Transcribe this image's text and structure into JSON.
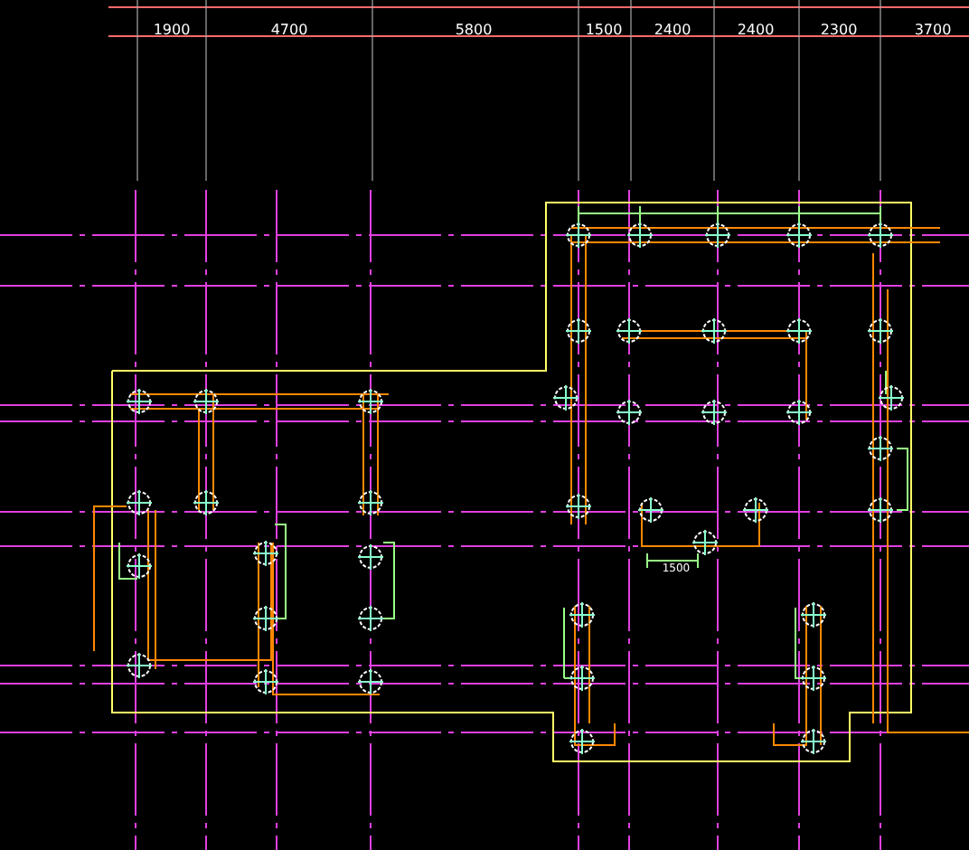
{
  "drawing": {
    "top_dimensions": [
      "1900",
      "4700",
      "5800",
      "1500",
      "2400",
      "2400",
      "2300",
      "3700"
    ],
    "inner_dimensions": [
      "1500"
    ]
  }
}
